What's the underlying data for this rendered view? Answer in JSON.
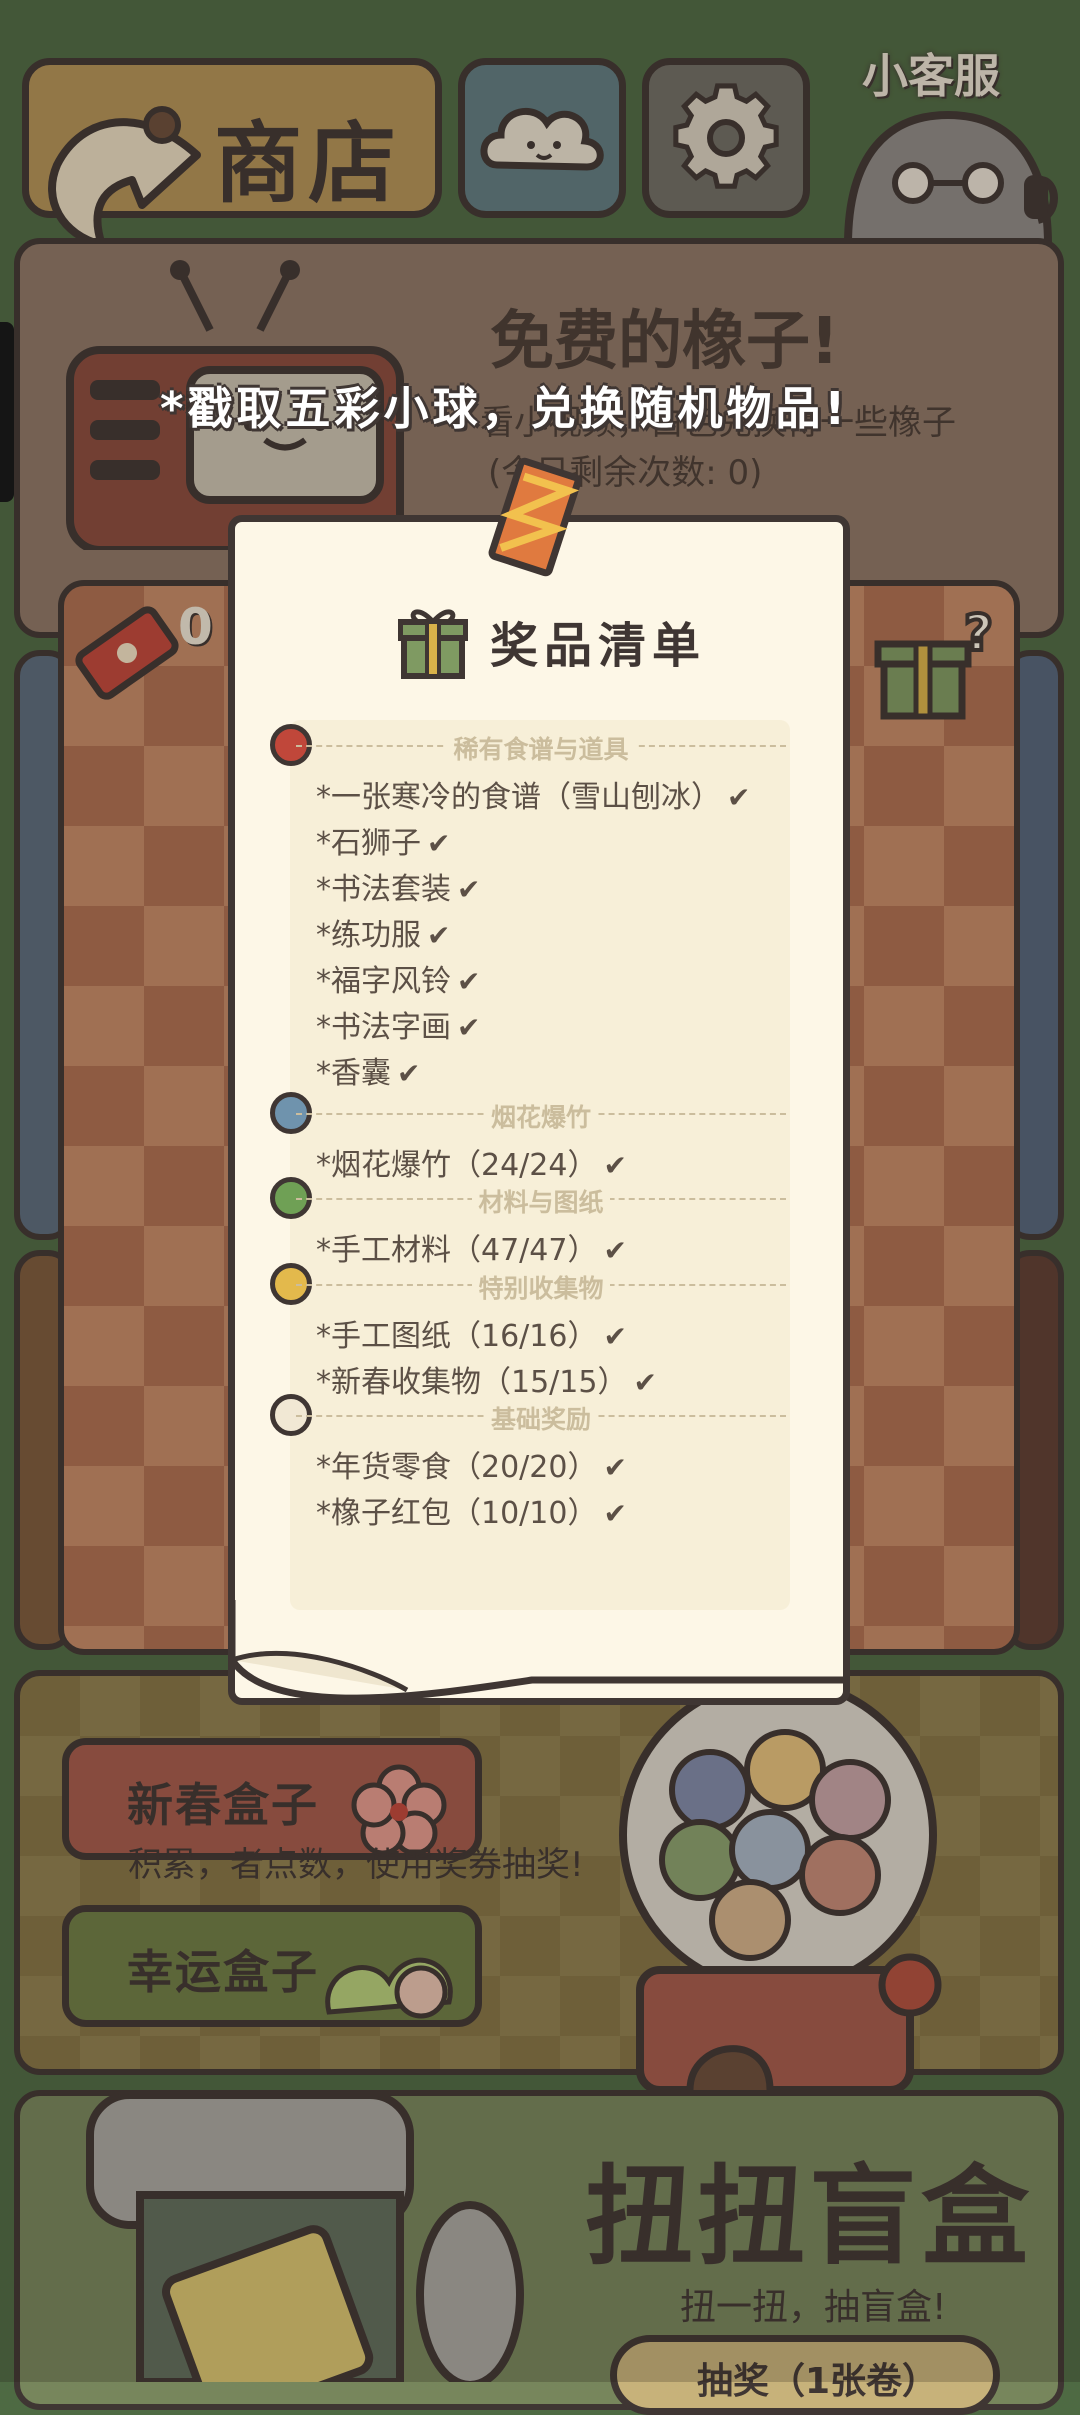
{
  "header": {
    "shop_label": "商店",
    "customer_service_label": "小客服"
  },
  "free_acorn": {
    "title": "免费的橡子!",
    "line1": "看小视频，白色兑换得一些橡子",
    "line2": "(今日剩余次数: 0)"
  },
  "tip_text": "*戳取五彩小球，兑换随机物品!",
  "ticket_count": "0",
  "prize_list": {
    "title": "奖品清单",
    "sections": [
      {
        "label": "稀有食谱与道具",
        "ball_color": "#c0473a",
        "items": [
          "*一张寒冷的食谱（雪山刨冰）",
          "*石狮子",
          "*书法套装",
          "*练功服",
          "*福字风铃",
          "*书法字画",
          "*香囊"
        ]
      },
      {
        "label": "烟花爆竹",
        "ball_color": "#6f93ad",
        "items": [
          "*烟花爆竹（24/24）"
        ]
      },
      {
        "label": "材料与图纸",
        "ball_color": "#6fa055",
        "items": [
          "*手工材料（47/47）"
        ]
      },
      {
        "label": "特别收集物",
        "ball_color": "#e3b94c",
        "items": [
          "*手工图纸（16/16）",
          "*新春收集物（15/15）"
        ]
      },
      {
        "label": "基础奖励",
        "ball_color": "#f1e8d4",
        "items": [
          "*年货零食（20/20）",
          "*橡子红包（10/10）"
        ]
      }
    ],
    "check_glyph": "✔"
  },
  "boxes": {
    "spring_box_label": "新春盒子",
    "subtitle": "积累，者点数，使用奖券抽奖!",
    "lucky_box_label": "幸运盒子"
  },
  "gashapon": {
    "title": "扭扭盲盒",
    "subtitle": "扭一扭，抽盲盒!",
    "draw_label": "抽奖（1张卷）"
  },
  "icons": {
    "back": "back-arrow-icon",
    "cloud": "cloud-icon",
    "gear": "gear-icon",
    "ticket": "ticket-icon",
    "gift": "gift-icon",
    "gift_question": "gift-question-icon"
  }
}
